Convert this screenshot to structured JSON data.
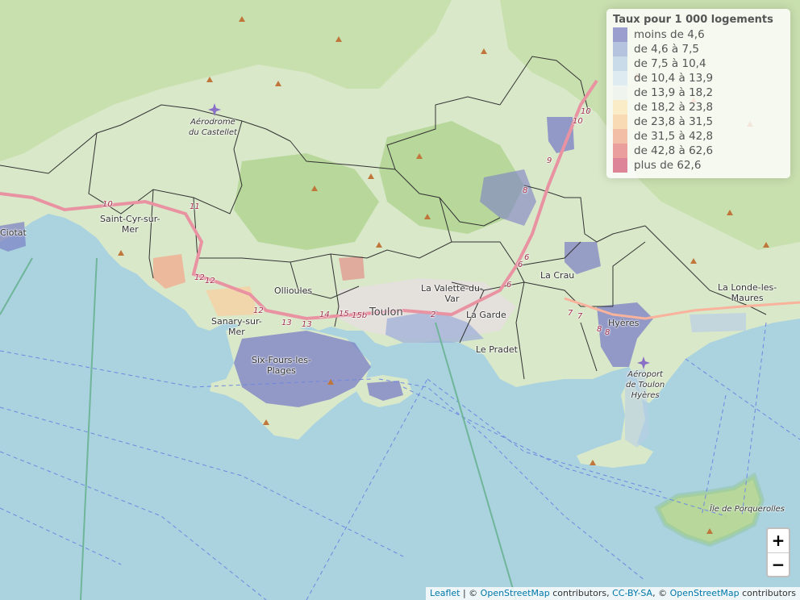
{
  "legend": {
    "title": "Taux pour 1 000 logements",
    "items": [
      {
        "label": "moins de 4,6",
        "color": "#7b7fc4"
      },
      {
        "label": "de 4,6 à 7,5",
        "color": "#9fb0d8"
      },
      {
        "label": "de 7,5 à 10,4",
        "color": "#b9cfe6"
      },
      {
        "label": "de 10,4 à 13,9",
        "color": "#d6e6f0"
      },
      {
        "label": "de 13,9 à 18,2",
        "color": "#eef2ee"
      },
      {
        "label": "de 18,2 à 23,8",
        "color": "#f9e7b9"
      },
      {
        "label": "de 23,8 à 31,5",
        "color": "#f8cfa0"
      },
      {
        "label": "de 31,5 à 42,8",
        "color": "#f1a98e"
      },
      {
        "label": "de 42,8 à 62,6",
        "color": "#e58080"
      },
      {
        "label": "plus de 62,6",
        "color": "#d45c78"
      }
    ]
  },
  "places": {
    "ciotat": "Ciotat",
    "saint_cyr": "Saint-Cyr-sur-\nMer",
    "aerodrome_castellet": "Aérodrome\ndu Castellet",
    "ollioules": "Ollioules",
    "sanary": "Sanary-sur-\nMer",
    "six_fours": "Six-Fours-les-\nPlages",
    "toulon": "Toulon",
    "la_valette": "La Valette-du-\nVar",
    "la_garde": "La Garde",
    "le_pradet": "Le Pradet",
    "la_crau": "La Crau",
    "hyeres": "Hyères",
    "aeroport_toulon_hyeres": "Aéroport\nde Toulon\nHyères",
    "la_londe": "La Londe-les-\nMaures",
    "porquerolles": "Île de Porquerolles"
  },
  "roads": [
    "10",
    "11",
    "12",
    "12",
    "12",
    "13",
    "13",
    "14",
    "15",
    "15b",
    "2",
    "6",
    "6",
    "6",
    "7",
    "7",
    "8",
    "8",
    "8",
    "9",
    "10",
    "10"
  ],
  "zoom": {
    "in": "+",
    "out": "−"
  },
  "attribution": {
    "leaflet": "Leaflet",
    "sep1": " | © ",
    "osm1": "OpenStreetMap",
    "contributors1": " contributors, ",
    "ccbysa": "CC-BY-SA",
    "sep2": ", © ",
    "osm2": "OpenStreetMap",
    "contributors2": " contributors"
  }
}
